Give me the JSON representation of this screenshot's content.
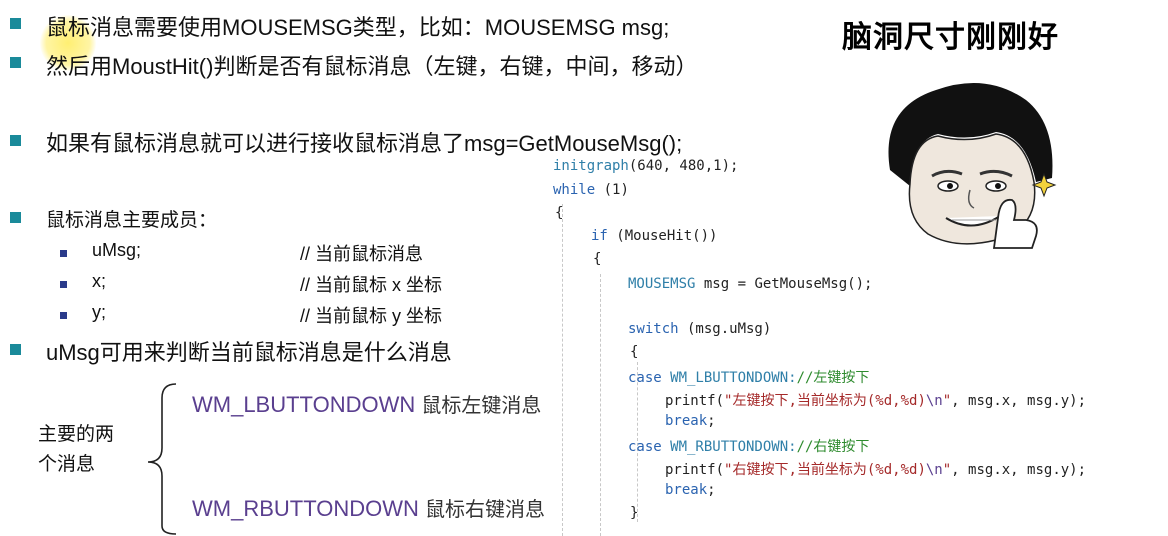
{
  "bullets": {
    "b1": "鼠标消息需要使用MOUSEMSG类型，比如：MOUSEMSG msg;",
    "b2": "然后用MoustHit()判断是否有鼠标消息（左键，右键，中间，移动）",
    "b3": "如果有鼠标消息就可以进行接收鼠标消息了msg=GetMouseMsg();",
    "b4": "鼠标消息主要成员：",
    "b5": "uMsg可用来判断当前鼠标消息是什么消息"
  },
  "members": [
    {
      "name": "uMsg;",
      "comment": "// 当前鼠标消息"
    },
    {
      "name": "x;",
      "comment": "// 当前鼠标 x 坐标"
    },
    {
      "name": "y;",
      "comment": "// 当前鼠标 y 坐标"
    }
  ],
  "messages": {
    "label_line1": "主要的两",
    "label_line2": "个消息",
    "left_name": "WM_LBUTTONDOWN",
    "left_desc": "鼠标左键消息",
    "right_name": "WM_RBUTTONDOWN",
    "right_desc": "鼠标右键消息"
  },
  "meme": {
    "title": "脑洞尺寸刚刚好"
  },
  "code": {
    "l1_fn": "initgraph",
    "l1_args": "(640, 480,1);",
    "l2_kw": "while",
    "l2_rest": " (1)",
    "l3": "{",
    "l4_kw": "if",
    "l4_rest": " (MouseHit())",
    "l5": "{",
    "l6_type": "MOUSEMSG",
    "l6_rest": " msg = GetMouseMsg();",
    "l7_kw": "switch",
    "l7_rest": " (msg.uMsg)",
    "l8": "{",
    "l9_kw": "case",
    "l9_const": " WM_LBUTTONDOWN:",
    "l9_cmt": "//左键按下",
    "l10_fn": "printf(",
    "l10_str": "\"左键按下,当前坐标为(%d,%d)",
    "l10_esc": "\\n",
    "l10_strend": "\"",
    "l10_rest": ", msg.x, msg.y);",
    "l11_kw": "break",
    "l11_rest": ";",
    "l12_kw": "case",
    "l12_const": " WM_RBUTTONDOWN:",
    "l12_cmt": "//右键按下",
    "l13_fn": "printf(",
    "l13_str": "\"右键按下,当前坐标为(%d,%d)",
    "l13_esc": "\\n",
    "l13_strend": "\"",
    "l13_rest": ", msg.x, msg.y);",
    "l14_kw": "break",
    "l14_rest": ";",
    "l15": "}"
  },
  "colors": {
    "bullet": "#1a8a9a",
    "sub_bullet": "#2a3a8a",
    "message_text": "#5a3f8f",
    "keyword": "#2a63b0",
    "comment": "#2e8b2e"
  }
}
